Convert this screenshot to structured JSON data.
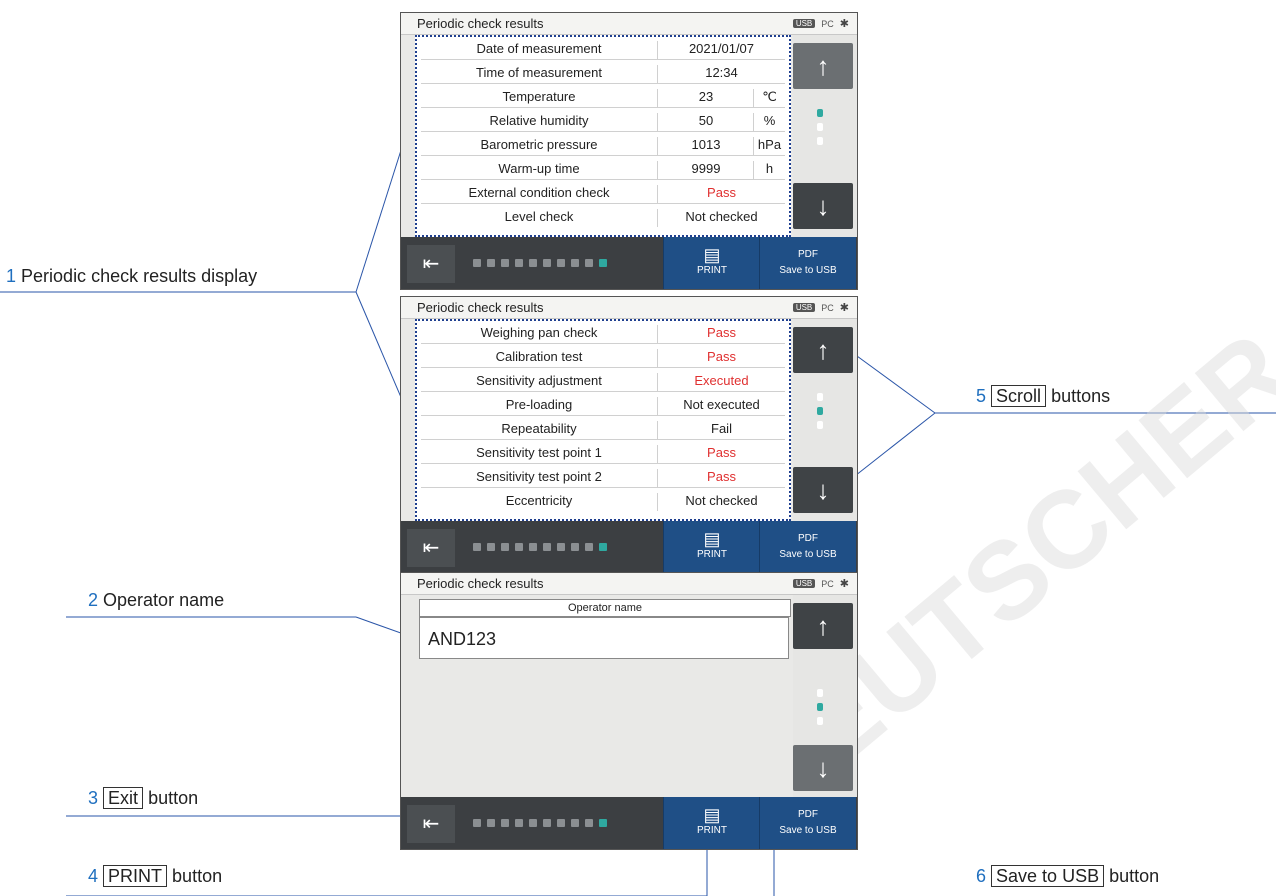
{
  "panels": [
    {
      "title": "Periodic check results",
      "rows": [
        {
          "label": "Date of measurement",
          "value": "2021/01/07",
          "unit": "",
          "red": false
        },
        {
          "label": "Time of measurement",
          "value": "12:34",
          "unit": "",
          "red": false
        },
        {
          "label": "Temperature",
          "value": "23",
          "unit": "℃",
          "red": false
        },
        {
          "label": "Relative humidity",
          "value": "50",
          "unit": "%",
          "red": false
        },
        {
          "label": "Barometric pressure",
          "value": "1013",
          "unit": "hPa",
          "red": false
        },
        {
          "label": "Warm-up time",
          "value": "9999",
          "unit": "h",
          "red": false
        },
        {
          "label": "External condition check",
          "value": "Pass",
          "unit": "",
          "red": true
        },
        {
          "label": "Level check",
          "value": "Not checked",
          "unit": "",
          "red": false
        }
      ]
    },
    {
      "title": "Periodic check results",
      "rows": [
        {
          "label": "Weighing pan check",
          "value": "Pass",
          "red": true
        },
        {
          "label": "Calibration test",
          "value": "Pass",
          "red": true
        },
        {
          "label": "Sensitivity adjustment",
          "value": "Executed",
          "red": true
        },
        {
          "label": "Pre-loading",
          "value": "Not executed",
          "red": false
        },
        {
          "label": "Repeatability",
          "value": "Fail",
          "red": false
        },
        {
          "label": "Sensitivity test point 1",
          "value": "Pass",
          "red": true
        },
        {
          "label": "Sensitivity test point 2",
          "value": "Pass",
          "red": true
        },
        {
          "label": "Eccentricity",
          "value": "Not checked",
          "red": false
        }
      ]
    },
    {
      "title": "Periodic check results",
      "operator_label": "Operator name",
      "operator_value": "AND123"
    }
  ],
  "status": {
    "usb": "USB",
    "pc": "PC"
  },
  "buttons": {
    "print": "PRINT",
    "save": "Save to USB",
    "save_icon": "PDF"
  },
  "callouts": {
    "c1": {
      "num": "1",
      "text": "Periodic check results display"
    },
    "c2": {
      "num": "2",
      "text": "Operator name"
    },
    "c3": {
      "num": "3",
      "boxed": "Exit",
      "text": "button"
    },
    "c4": {
      "num": "4",
      "boxed": "PRINT",
      "text": "button"
    },
    "c5": {
      "num": "5",
      "boxed": "Scroll",
      "text": "buttons"
    },
    "c6": {
      "num": "6",
      "boxed": "Save to USB",
      "text": "button"
    }
  },
  "colors": {
    "accent": "#1f4f86",
    "pass_red": "#e03030",
    "callout_blue": "#1f6fbf"
  }
}
